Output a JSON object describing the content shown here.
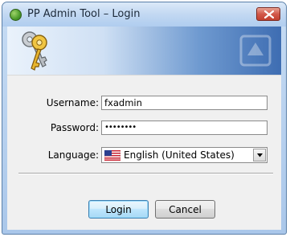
{
  "window": {
    "title": "PP Admin Tool – Login"
  },
  "icons": {
    "app": "app-globe-icon",
    "close": "close-icon",
    "banner": "keys-icon",
    "flag": "us-flag-icon",
    "dropdown": "chevron-down-icon"
  },
  "form": {
    "username_label": "Username:",
    "username_value": "fxadmin",
    "password_label": "Password:",
    "password_display": "••••••••",
    "language_label": "Language:",
    "language_selected": "English (United States)"
  },
  "buttons": {
    "login": "Login",
    "cancel": "Cancel"
  },
  "colors": {
    "titlebar": "#c2d8f2",
    "close_button": "#d2584a",
    "default_button_border": "#3c7fb1"
  }
}
